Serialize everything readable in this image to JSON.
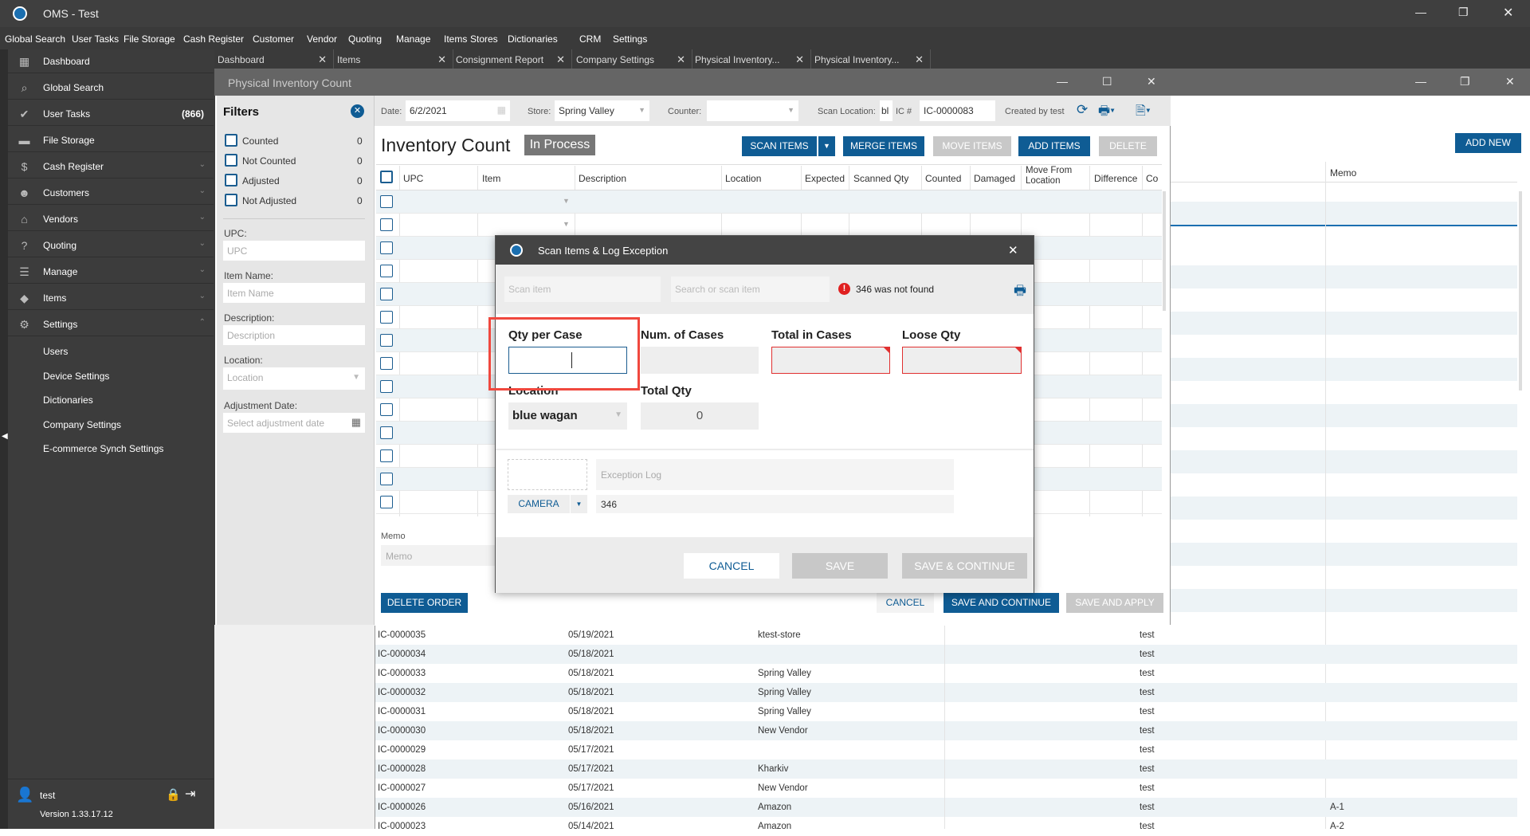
{
  "app": {
    "title": "OMS - Test"
  },
  "menu": [
    "Global Search",
    "User Tasks",
    "File Storage",
    "Cash Register",
    "Customer",
    "Vendor",
    "Quoting",
    "Manage",
    "Items",
    "Stores",
    "Dictionaries",
    "CRM",
    "Settings"
  ],
  "sidebar": {
    "items": [
      {
        "label": "Dashboard",
        "icon": "dashboard-icon",
        "glyph": "▦"
      },
      {
        "label": "Global Search",
        "icon": "search-icon",
        "glyph": "⌕"
      },
      {
        "label": "User Tasks",
        "icon": "check-circle-icon",
        "glyph": "✔",
        "count": "(866)"
      },
      {
        "label": "File Storage",
        "icon": "folder-icon",
        "glyph": "▬"
      },
      {
        "label": "Cash Register",
        "icon": "dollar-icon",
        "glyph": "$",
        "chev": "⌄"
      },
      {
        "label": "Customers",
        "icon": "person-icon",
        "glyph": "☻",
        "chev": "⌄"
      },
      {
        "label": "Vendors",
        "icon": "store-icon",
        "glyph": "⌂",
        "chev": "⌄"
      },
      {
        "label": "Quoting",
        "icon": "quote-icon",
        "glyph": "?",
        "chev": "⌄"
      },
      {
        "label": "Manage",
        "icon": "clipboard-icon",
        "glyph": "☰",
        "chev": "⌄"
      },
      {
        "label": "Items",
        "icon": "tag-icon",
        "glyph": "◆",
        "chev": "⌄"
      },
      {
        "label": "Settings",
        "icon": "gear-icon",
        "glyph": "⚙",
        "chev": "⌃"
      }
    ],
    "sub": [
      "Users",
      "Device Settings",
      "Dictionaries",
      "Company Settings",
      "E-commerce Synch Settings"
    ],
    "user": "test",
    "version": "Version 1.33.17.12"
  },
  "tabs": [
    "Dashboard",
    "Items",
    "Consignment Report",
    "Company Settings",
    "Physical Inventory...",
    "Physical Inventory..."
  ],
  "window": {
    "title": "Physical Inventory Count"
  },
  "filters": {
    "title": "Filters",
    "checks": [
      {
        "label": "Counted",
        "count": "0"
      },
      {
        "label": "Not Counted",
        "count": "0"
      },
      {
        "label": "Adjusted",
        "count": "0"
      },
      {
        "label": "Not Adjusted",
        "count": "0"
      }
    ],
    "upc_label": "UPC:",
    "upc_ph": "UPC",
    "item_label": "Item Name:",
    "item_ph": "Item Name",
    "desc_label": "Description:",
    "desc_ph": "Description",
    "loc_label": "Location:",
    "loc_ph": "Location",
    "date_label": "Adjustment Date:",
    "date_ph": "Select adjustment date"
  },
  "toolbar": {
    "date_label": "Date:",
    "date": "6/2/2021",
    "store_label": "Store:",
    "store": "Spring Valley",
    "counter_label": "Counter:",
    "counter": "",
    "scanloc_label": "Scan Location:",
    "scanloc": "bl",
    "ic_label": "IC #",
    "ic": "IC-0000083",
    "created": "Created by test"
  },
  "count": {
    "heading": "Inventory Count",
    "status": "In Process",
    "scan": "SCAN ITEMS",
    "merge": "MERGE ITEMS",
    "move": "MOVE ITEMS",
    "add": "ADD ITEMS",
    "delete": "DELETE",
    "columns": [
      "UPC",
      "Item",
      "Description",
      "Location",
      "Expected",
      "Scanned Qty",
      "Counted",
      "Damaged",
      "Move From Location",
      "Difference",
      "Co"
    ],
    "memo_label": "Memo",
    "memo_ph": "Memo",
    "delete_order": "DELETE ORDER",
    "cancel": "CANCEL",
    "save_continue": "SAVE AND CONTINUE",
    "save_apply": "SAVE AND APPLY"
  },
  "background": {
    "add_new": "ADD NEW",
    "memo_col": "Memo"
  },
  "list": [
    [
      "IC-0000035",
      "05/19/2021",
      "ktest-store",
      "test",
      ""
    ],
    [
      "IC-0000034",
      "05/18/2021",
      "",
      "test",
      ""
    ],
    [
      "IC-0000033",
      "05/18/2021",
      "Spring Valley",
      "test",
      ""
    ],
    [
      "IC-0000032",
      "05/18/2021",
      "Spring Valley",
      "test",
      ""
    ],
    [
      "IC-0000031",
      "05/18/2021",
      "Spring Valley",
      "test",
      ""
    ],
    [
      "IC-0000030",
      "05/18/2021",
      "New Vendor",
      "test",
      ""
    ],
    [
      "IC-0000029",
      "05/17/2021",
      "",
      "test",
      ""
    ],
    [
      "IC-0000028",
      "05/17/2021",
      "Kharkiv",
      "test",
      ""
    ],
    [
      "IC-0000027",
      "05/17/2021",
      "New Vendor",
      "test",
      ""
    ],
    [
      "IC-0000026",
      "05/16/2021",
      "Amazon",
      "test",
      "A-1"
    ],
    [
      "IC-0000023",
      "05/14/2021",
      "Amazon",
      "test",
      "A-2"
    ]
  ],
  "dialog": {
    "title": "Scan Items & Log Exception",
    "scan_ph": "Scan item",
    "search_ph": "Search or scan item",
    "error": "346 was not found",
    "qty_case": "Qty per Case",
    "num_cases": "Num. of Cases",
    "total_cases": "Total in Cases",
    "loose": "Loose Qty",
    "location": "Location",
    "location_value": "blue wagan",
    "total_qty": "Total Qty",
    "total_qty_value": "0",
    "exception_ph": "Exception Log",
    "camera": "CAMERA",
    "code": "346",
    "cancel": "CANCEL",
    "save": "SAVE",
    "save_continue": "SAVE & CONTINUE"
  },
  "colors": {
    "accent": "#0f5c94",
    "error": "#e02020",
    "highlight": "#f0483e"
  }
}
